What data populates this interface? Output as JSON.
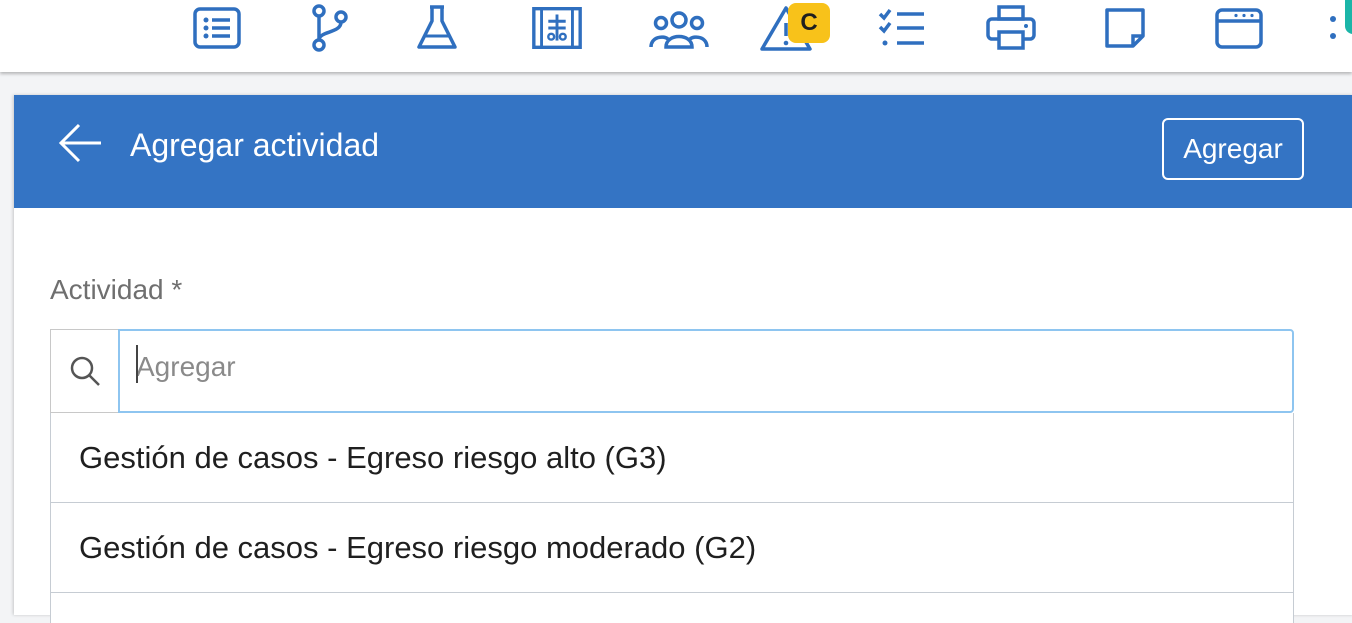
{
  "toolbar": {
    "items": [
      {
        "icon": "list-icon"
      },
      {
        "icon": "branch-icon"
      },
      {
        "icon": "flask-icon"
      },
      {
        "icon": "chart-panel-icon"
      },
      {
        "icon": "users-icon"
      },
      {
        "icon": "warning-icon"
      },
      {
        "icon": "checklist-icon"
      },
      {
        "icon": "printer-icon"
      },
      {
        "icon": "note-icon"
      },
      {
        "icon": "window-icon"
      }
    ],
    "alert_badge": "C"
  },
  "header": {
    "title": "Agregar actividad",
    "add_button": "Agregar",
    "color": "#3474c4"
  },
  "form": {
    "field_label": "Actividad *",
    "search_placeholder": "Agregar",
    "search_value": "",
    "options": [
      "Gestión de casos - Egreso riesgo alto (G3)",
      "Gestión de casos - Egreso riesgo moderado (G2)"
    ]
  }
}
